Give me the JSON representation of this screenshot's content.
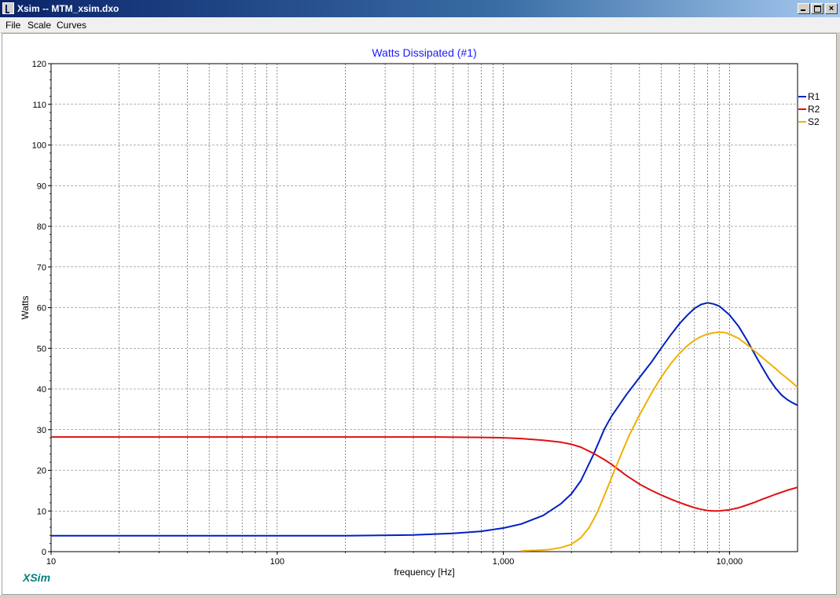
{
  "window": {
    "title": "Xsim -- MTM_xsim.dxo",
    "close_glyph": "×"
  },
  "menu": {
    "items": [
      "File",
      "Scale",
      "Curves"
    ]
  },
  "brand": {
    "logo_text": "XSim",
    "color": "#008080"
  },
  "chart_data": {
    "type": "line",
    "title": "Watts Dissipated (#1)",
    "title_color": "#1a1aff",
    "xlabel": "frequency [Hz]",
    "ylabel": "Watts",
    "x_scale": "log",
    "xlim": [
      10,
      20000
    ],
    "ylim": [
      0,
      120
    ],
    "x_ticks": [
      10,
      100,
      1000,
      10000
    ],
    "x_tick_labels": [
      "10",
      "100",
      "1,000",
      "10,000"
    ],
    "y_ticks": [
      0,
      10,
      20,
      30,
      40,
      50,
      60,
      70,
      80,
      90,
      100,
      110,
      120
    ],
    "grid": true,
    "legend_position": "top-right",
    "series": [
      {
        "name": "R1",
        "color": "#0020c0",
        "points": [
          [
            10,
            3.9
          ],
          [
            100,
            3.9
          ],
          [
            200,
            3.9
          ],
          [
            400,
            4.1
          ],
          [
            600,
            4.5
          ],
          [
            800,
            5.0
          ],
          [
            1000,
            5.8
          ],
          [
            1200,
            6.8
          ],
          [
            1500,
            8.9
          ],
          [
            1800,
            11.8
          ],
          [
            2000,
            14.2
          ],
          [
            2200,
            17.4
          ],
          [
            2500,
            23.8
          ],
          [
            2800,
            30.2
          ],
          [
            3000,
            33.2
          ],
          [
            3500,
            38.6
          ],
          [
            4000,
            42.8
          ],
          [
            4500,
            46.5
          ],
          [
            5000,
            50.1
          ],
          [
            5500,
            53.3
          ],
          [
            6000,
            56.0
          ],
          [
            6500,
            58.1
          ],
          [
            7000,
            59.8
          ],
          [
            7500,
            60.8
          ],
          [
            8000,
            61.2
          ],
          [
            8500,
            60.9
          ],
          [
            9000,
            60.4
          ],
          [
            10000,
            58.2
          ],
          [
            11000,
            55.3
          ],
          [
            12000,
            51.8
          ],
          [
            13000,
            48.3
          ],
          [
            14000,
            45.2
          ],
          [
            15000,
            42.4
          ],
          [
            16000,
            40.2
          ],
          [
            17000,
            38.5
          ],
          [
            18000,
            37.4
          ],
          [
            19000,
            36.6
          ],
          [
            20000,
            36.0
          ]
        ]
      },
      {
        "name": "R2",
        "color": "#e01010",
        "points": [
          [
            10,
            28.2
          ],
          [
            100,
            28.2
          ],
          [
            200,
            28.2
          ],
          [
            500,
            28.2
          ],
          [
            800,
            28.1
          ],
          [
            1000,
            28.0
          ],
          [
            1200,
            27.8
          ],
          [
            1500,
            27.4
          ],
          [
            1800,
            26.9
          ],
          [
            2000,
            26.4
          ],
          [
            2200,
            25.7
          ],
          [
            2500,
            24.2
          ],
          [
            2800,
            22.6
          ],
          [
            3000,
            21.5
          ],
          [
            3500,
            18.7
          ],
          [
            4000,
            16.6
          ],
          [
            4500,
            15.1
          ],
          [
            5000,
            13.9
          ],
          [
            5500,
            12.9
          ],
          [
            6000,
            12.1
          ],
          [
            6500,
            11.4
          ],
          [
            7000,
            10.8
          ],
          [
            7500,
            10.4
          ],
          [
            8000,
            10.1
          ],
          [
            8500,
            10.0
          ],
          [
            9000,
            10.0
          ],
          [
            10000,
            10.3
          ],
          [
            11000,
            10.8
          ],
          [
            12000,
            11.5
          ],
          [
            13000,
            12.2
          ],
          [
            14000,
            12.9
          ],
          [
            15000,
            13.5
          ],
          [
            16000,
            14.1
          ],
          [
            17000,
            14.6
          ],
          [
            18000,
            15.1
          ],
          [
            20000,
            15.8
          ]
        ]
      },
      {
        "name": "S2",
        "color": "#f0b000",
        "points": [
          [
            1200,
            0.2
          ],
          [
            1400,
            0.3
          ],
          [
            1600,
            0.5
          ],
          [
            1800,
            1.0
          ],
          [
            2000,
            1.8
          ],
          [
            2200,
            3.4
          ],
          [
            2400,
            6.0
          ],
          [
            2600,
            9.6
          ],
          [
            2800,
            13.9
          ],
          [
            3000,
            18.0
          ],
          [
            3300,
            23.6
          ],
          [
            3600,
            28.6
          ],
          [
            4000,
            33.6
          ],
          [
            4500,
            38.8
          ],
          [
            5000,
            43.0
          ],
          [
            5500,
            46.2
          ],
          [
            6000,
            48.7
          ],
          [
            6500,
            50.6
          ],
          [
            7000,
            52.0
          ],
          [
            7500,
            52.9
          ],
          [
            8000,
            53.5
          ],
          [
            8500,
            53.8
          ],
          [
            9000,
            54.0
          ],
          [
            9500,
            53.9
          ],
          [
            10000,
            53.5
          ],
          [
            11000,
            52.4
          ],
          [
            12000,
            50.8
          ],
          [
            13000,
            49.2
          ],
          [
            14000,
            47.7
          ],
          [
            15000,
            46.3
          ],
          [
            16000,
            45.0
          ],
          [
            17000,
            43.7
          ],
          [
            18000,
            42.6
          ],
          [
            19000,
            41.5
          ],
          [
            20000,
            40.4
          ]
        ]
      }
    ]
  }
}
